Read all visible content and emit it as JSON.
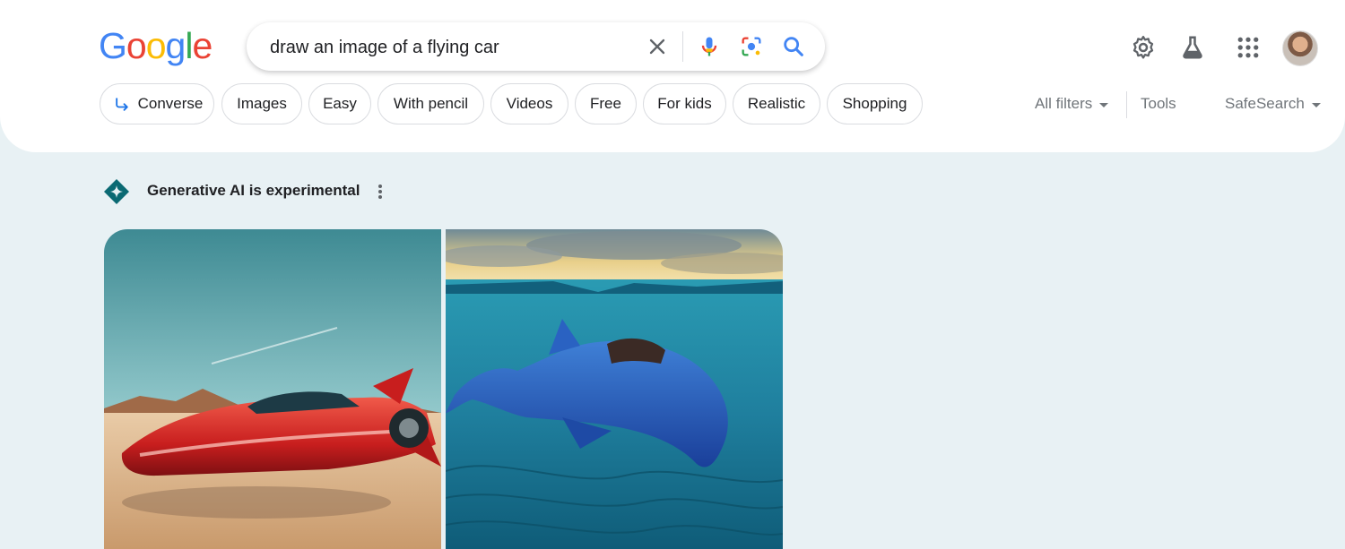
{
  "logo": {
    "letters": [
      "G",
      "o",
      "o",
      "g",
      "l",
      "e"
    ],
    "colors": [
      "#4285f4",
      "#ea4335",
      "#fbbc05",
      "#4285f4",
      "#34a853",
      "#ea4335"
    ]
  },
  "search": {
    "query": "draw an image of a flying car"
  },
  "icons": {
    "clear": "close-icon",
    "voice": "microphone-icon",
    "lens": "lens-camera-icon",
    "search": "search-icon",
    "settings": "gear-icon",
    "labs": "flask-icon",
    "apps": "apps-grid-icon",
    "converse": "converse-arrow-icon",
    "generative": "gemini-sparkle-icon",
    "more": "more-vertical-icon"
  },
  "chips": [
    {
      "label": "Converse"
    },
    {
      "label": "Images"
    },
    {
      "label": "Easy"
    },
    {
      "label": "With pencil"
    },
    {
      "label": "Videos"
    },
    {
      "label": "Free"
    },
    {
      "label": "For kids"
    },
    {
      "label": "Realistic"
    },
    {
      "label": "Shopping"
    }
  ],
  "tools": {
    "all_filters": "All filters",
    "tools": "Tools",
    "safesearch": "SafeSearch"
  },
  "generative": {
    "label": "Generative AI is experimental"
  },
  "colors": {
    "accent_blue": "#4285f4",
    "page_background": "#e8f1f4",
    "gemini_teal": "#0b6a73"
  }
}
